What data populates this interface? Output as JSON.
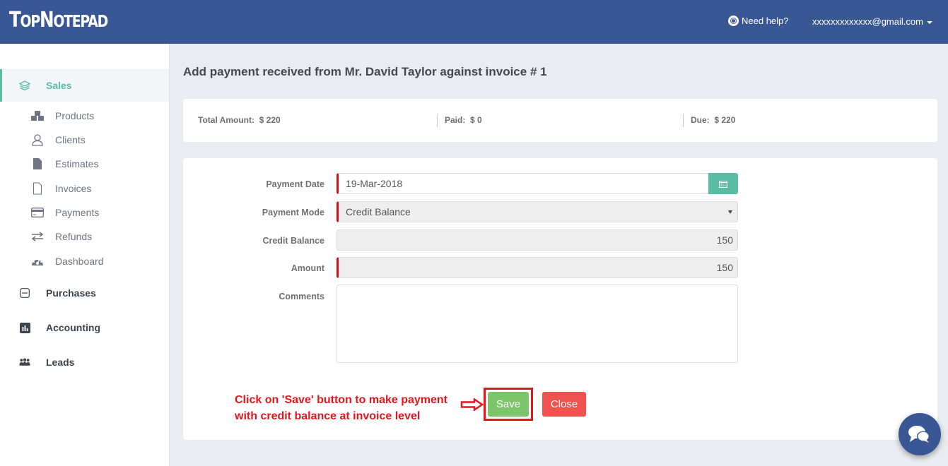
{
  "header": {
    "logo_big_t": "T",
    "logo_op": "OP",
    "logo_big_n": "N",
    "logo_otepad": "OTEPAD",
    "help_label": "Need help?",
    "account_email": "xxxxxxxxxxxxx@gmail.com"
  },
  "sidebar": {
    "sales": "Sales",
    "sales_items": [
      {
        "label": "Products",
        "icon": "cubes-icon"
      },
      {
        "label": "Clients",
        "icon": "user-icon"
      },
      {
        "label": "Estimates",
        "icon": "file-filled-icon"
      },
      {
        "label": "Invoices",
        "icon": "file-outline-icon"
      },
      {
        "label": "Payments",
        "icon": "credit-card-icon"
      },
      {
        "label": "Refunds",
        "icon": "exchange-icon"
      },
      {
        "label": "Dashboard",
        "icon": "dashboard-icon"
      }
    ],
    "purchases": "Purchases",
    "accounting": "Accounting",
    "leads": "Leads"
  },
  "page": {
    "title": "Add payment received from Mr. David Taylor against invoice # 1"
  },
  "summary": {
    "total_label": "Total Amount:",
    "total_value": "$ 220",
    "paid_label": "Paid:",
    "paid_value": "$ 0",
    "due_label": "Due:",
    "due_value": "$ 220"
  },
  "form": {
    "payment_date_label": "Payment Date",
    "payment_date_value": "19-Mar-2018",
    "payment_mode_label": "Payment Mode",
    "payment_mode_value": "Credit Balance",
    "credit_balance_label": "Credit Balance",
    "credit_balance_value": "150",
    "amount_label": "Amount",
    "amount_value": "150",
    "comments_label": "Comments",
    "comments_value": "",
    "save_label": "Save",
    "close_label": "Close"
  },
  "annotation": {
    "line1": "Click on 'Save' button to make payment",
    "line2": "with credit balance at invoice level",
    "color": "#e8141b"
  },
  "colors": {
    "brand": "#3a5795",
    "accent": "#5bbca4",
    "save": "#7cc56a",
    "close": "#ef5350",
    "required": "#c9131d"
  }
}
